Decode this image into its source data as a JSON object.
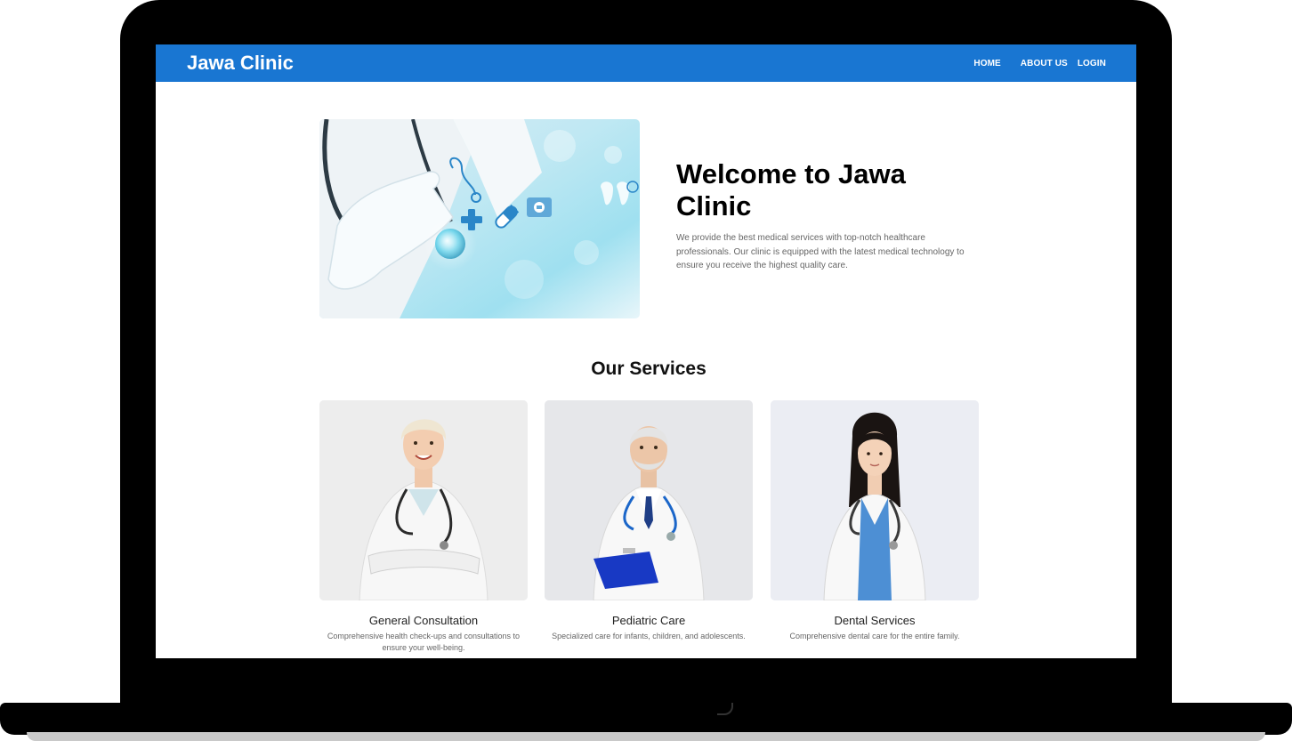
{
  "navbar": {
    "brand": "Jawa Clinic",
    "links": [
      {
        "label": "HOME"
      },
      {
        "label": "ABOUT US"
      },
      {
        "label": "LOGIN"
      }
    ]
  },
  "hero": {
    "title": "Welcome to Jawa Clinic",
    "description": "We provide the best medical services with top-notch healthcare professionals. Our clinic is equipped with the latest medical technology to ensure you receive the highest quality care.",
    "image_icon": "medical-technology-image"
  },
  "services": {
    "title": "Our Services",
    "items": [
      {
        "title": "General Consultation",
        "description": "Comprehensive health check-ups and consultations to ensure your well-being.",
        "image_icon": "female-doctor-photo"
      },
      {
        "title": "Pediatric Care",
        "description": "Specialized care for infants, children, and adolescents.",
        "image_icon": "senior-male-doctor-photo"
      },
      {
        "title": "Dental Services",
        "description": "Comprehensive dental care for the entire family.",
        "image_icon": "young-female-doctor-photo"
      }
    ]
  },
  "colors": {
    "primary": "#1976d2",
    "heading": "#000000",
    "body_text": "#666666",
    "frame": "#000000"
  }
}
